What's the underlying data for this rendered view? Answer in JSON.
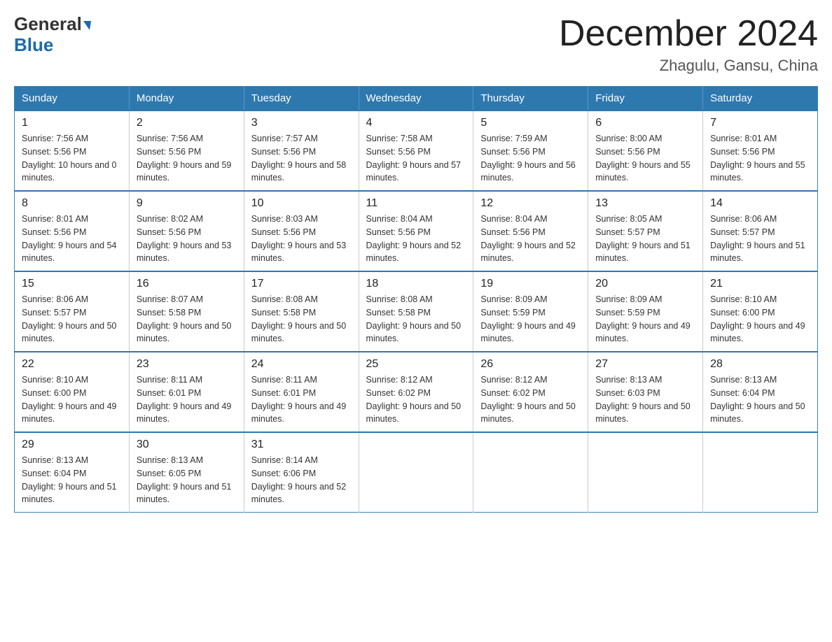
{
  "logo": {
    "part1": "General",
    "part2": "Blue"
  },
  "header": {
    "month": "December 2024",
    "location": "Zhagulu, Gansu, China"
  },
  "days_of_week": [
    "Sunday",
    "Monday",
    "Tuesday",
    "Wednesday",
    "Thursday",
    "Friday",
    "Saturday"
  ],
  "weeks": [
    [
      {
        "day": "1",
        "sunrise": "7:56 AM",
        "sunset": "5:56 PM",
        "daylight": "10 hours and 0 minutes."
      },
      {
        "day": "2",
        "sunrise": "7:56 AM",
        "sunset": "5:56 PM",
        "daylight": "9 hours and 59 minutes."
      },
      {
        "day": "3",
        "sunrise": "7:57 AM",
        "sunset": "5:56 PM",
        "daylight": "9 hours and 58 minutes."
      },
      {
        "day": "4",
        "sunrise": "7:58 AM",
        "sunset": "5:56 PM",
        "daylight": "9 hours and 57 minutes."
      },
      {
        "day": "5",
        "sunrise": "7:59 AM",
        "sunset": "5:56 PM",
        "daylight": "9 hours and 56 minutes."
      },
      {
        "day": "6",
        "sunrise": "8:00 AM",
        "sunset": "5:56 PM",
        "daylight": "9 hours and 55 minutes."
      },
      {
        "day": "7",
        "sunrise": "8:01 AM",
        "sunset": "5:56 PM",
        "daylight": "9 hours and 55 minutes."
      }
    ],
    [
      {
        "day": "8",
        "sunrise": "8:01 AM",
        "sunset": "5:56 PM",
        "daylight": "9 hours and 54 minutes."
      },
      {
        "day": "9",
        "sunrise": "8:02 AM",
        "sunset": "5:56 PM",
        "daylight": "9 hours and 53 minutes."
      },
      {
        "day": "10",
        "sunrise": "8:03 AM",
        "sunset": "5:56 PM",
        "daylight": "9 hours and 53 minutes."
      },
      {
        "day": "11",
        "sunrise": "8:04 AM",
        "sunset": "5:56 PM",
        "daylight": "9 hours and 52 minutes."
      },
      {
        "day": "12",
        "sunrise": "8:04 AM",
        "sunset": "5:56 PM",
        "daylight": "9 hours and 52 minutes."
      },
      {
        "day": "13",
        "sunrise": "8:05 AM",
        "sunset": "5:57 PM",
        "daylight": "9 hours and 51 minutes."
      },
      {
        "day": "14",
        "sunrise": "8:06 AM",
        "sunset": "5:57 PM",
        "daylight": "9 hours and 51 minutes."
      }
    ],
    [
      {
        "day": "15",
        "sunrise": "8:06 AM",
        "sunset": "5:57 PM",
        "daylight": "9 hours and 50 minutes."
      },
      {
        "day": "16",
        "sunrise": "8:07 AM",
        "sunset": "5:58 PM",
        "daylight": "9 hours and 50 minutes."
      },
      {
        "day": "17",
        "sunrise": "8:08 AM",
        "sunset": "5:58 PM",
        "daylight": "9 hours and 50 minutes."
      },
      {
        "day": "18",
        "sunrise": "8:08 AM",
        "sunset": "5:58 PM",
        "daylight": "9 hours and 50 minutes."
      },
      {
        "day": "19",
        "sunrise": "8:09 AM",
        "sunset": "5:59 PM",
        "daylight": "9 hours and 49 minutes."
      },
      {
        "day": "20",
        "sunrise": "8:09 AM",
        "sunset": "5:59 PM",
        "daylight": "9 hours and 49 minutes."
      },
      {
        "day": "21",
        "sunrise": "8:10 AM",
        "sunset": "6:00 PM",
        "daylight": "9 hours and 49 minutes."
      }
    ],
    [
      {
        "day": "22",
        "sunrise": "8:10 AM",
        "sunset": "6:00 PM",
        "daylight": "9 hours and 49 minutes."
      },
      {
        "day": "23",
        "sunrise": "8:11 AM",
        "sunset": "6:01 PM",
        "daylight": "9 hours and 49 minutes."
      },
      {
        "day": "24",
        "sunrise": "8:11 AM",
        "sunset": "6:01 PM",
        "daylight": "9 hours and 49 minutes."
      },
      {
        "day": "25",
        "sunrise": "8:12 AM",
        "sunset": "6:02 PM",
        "daylight": "9 hours and 50 minutes."
      },
      {
        "day": "26",
        "sunrise": "8:12 AM",
        "sunset": "6:02 PM",
        "daylight": "9 hours and 50 minutes."
      },
      {
        "day": "27",
        "sunrise": "8:13 AM",
        "sunset": "6:03 PM",
        "daylight": "9 hours and 50 minutes."
      },
      {
        "day": "28",
        "sunrise": "8:13 AM",
        "sunset": "6:04 PM",
        "daylight": "9 hours and 50 minutes."
      }
    ],
    [
      {
        "day": "29",
        "sunrise": "8:13 AM",
        "sunset": "6:04 PM",
        "daylight": "9 hours and 51 minutes."
      },
      {
        "day": "30",
        "sunrise": "8:13 AM",
        "sunset": "6:05 PM",
        "daylight": "9 hours and 51 minutes."
      },
      {
        "day": "31",
        "sunrise": "8:14 AM",
        "sunset": "6:06 PM",
        "daylight": "9 hours and 52 minutes."
      },
      null,
      null,
      null,
      null
    ]
  ]
}
